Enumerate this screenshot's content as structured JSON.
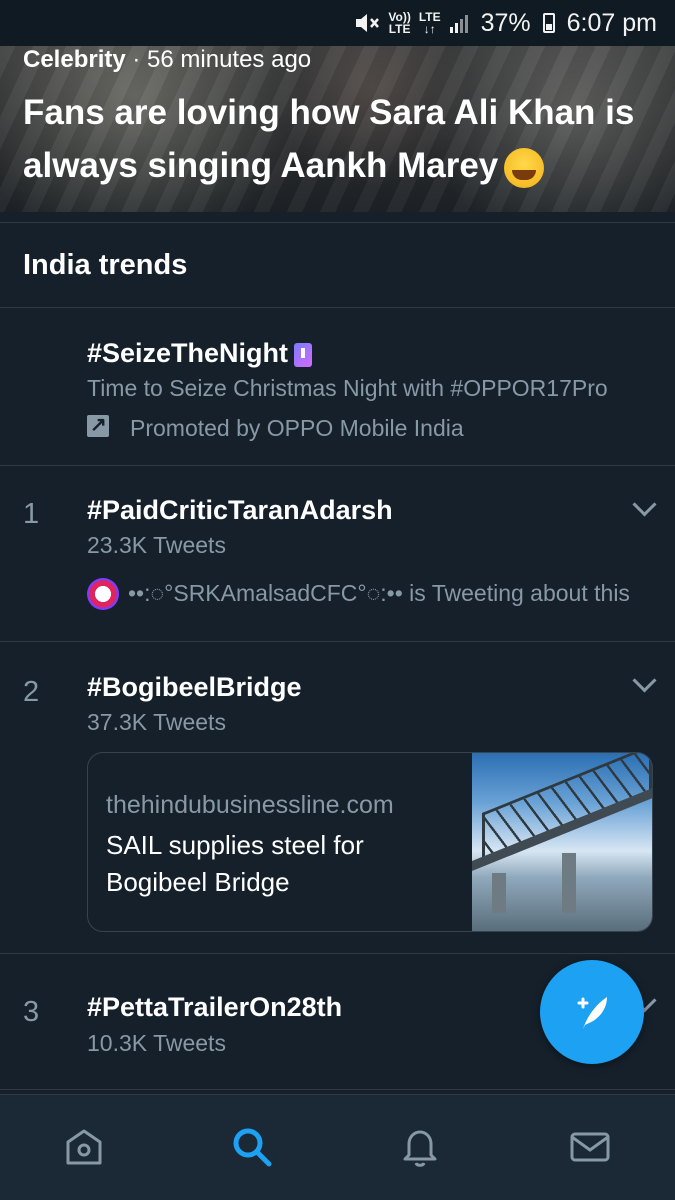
{
  "status_bar": {
    "volte": "Vo))",
    "volte_sub": "LTE",
    "lte": "LTE",
    "lte_sub": "↓↑",
    "battery": "37%",
    "time": "6:07 pm"
  },
  "hero": {
    "category": "Celebrity",
    "separator": " · ",
    "time_ago": "56 minutes ago",
    "headline": "Fans are loving how Sara Ali Khan is always singing Aankh Marey"
  },
  "section": {
    "title": "India trends"
  },
  "promoted": {
    "hashtag": "#SeizeTheNight",
    "description": "Time to Seize Christmas Night with #OPPOR17Pro",
    "promoted_by": "Promoted by OPPO Mobile India"
  },
  "trends": [
    {
      "rank": "1",
      "hashtag": "#PaidCriticTaranAdarsh",
      "tweets": "23.3K Tweets",
      "activity": "••:◌°SRKAmalsadCFC°◌:•• is Tweeting about this"
    },
    {
      "rank": "2",
      "hashtag": "#BogibeelBridge",
      "tweets": "37.3K Tweets",
      "card_domain": "thehindubusinessline.com",
      "card_title": "SAIL supplies steel for Bogibeel Bridge"
    },
    {
      "rank": "3",
      "hashtag": "#PettaTrailerOn28th",
      "tweets": "10.3K Tweets"
    }
  ],
  "tabs": [
    "home-icon",
    "search-icon",
    "notifications-icon",
    "messages-icon"
  ],
  "colors": {
    "background": "#15202b",
    "accent": "#1da1f2",
    "secondary_text": "#8899a6"
  }
}
